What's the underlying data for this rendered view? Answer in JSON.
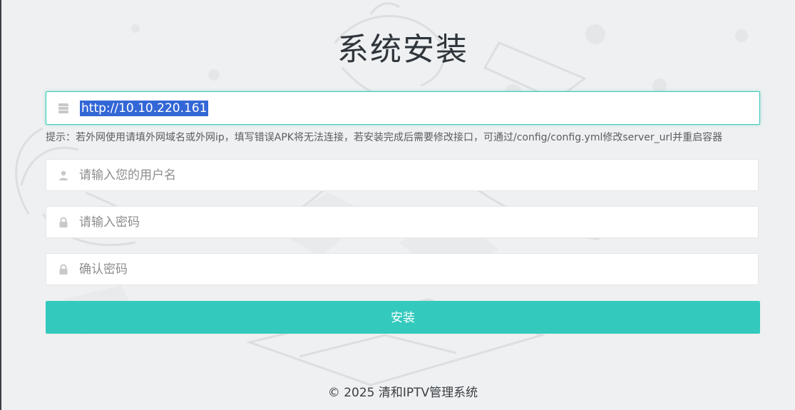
{
  "page": {
    "title": "系统安装",
    "footer": "© 2025 清和IPTV管理系统"
  },
  "form": {
    "server_url": {
      "value": "http://10.10.220.161",
      "icon": "server-icon"
    },
    "hint": "提示：若外网使用请填外网域名或外网ip，填写错误APK将无法连接，若安装完成后需要修改接口，可通过/config/config.yml修改server_url并重启容器",
    "username": {
      "placeholder": "请输入您的用户名",
      "icon": "user-icon"
    },
    "password": {
      "placeholder": "请输入密码",
      "icon": "lock-icon"
    },
    "confirm_password": {
      "placeholder": "确认密码",
      "icon": "lock-icon"
    },
    "submit_label": "安装"
  },
  "colors": {
    "accent": "#33cabd",
    "focus_border": "#37c8b8",
    "selection": "#3367d6",
    "background": "#eef0f1"
  }
}
